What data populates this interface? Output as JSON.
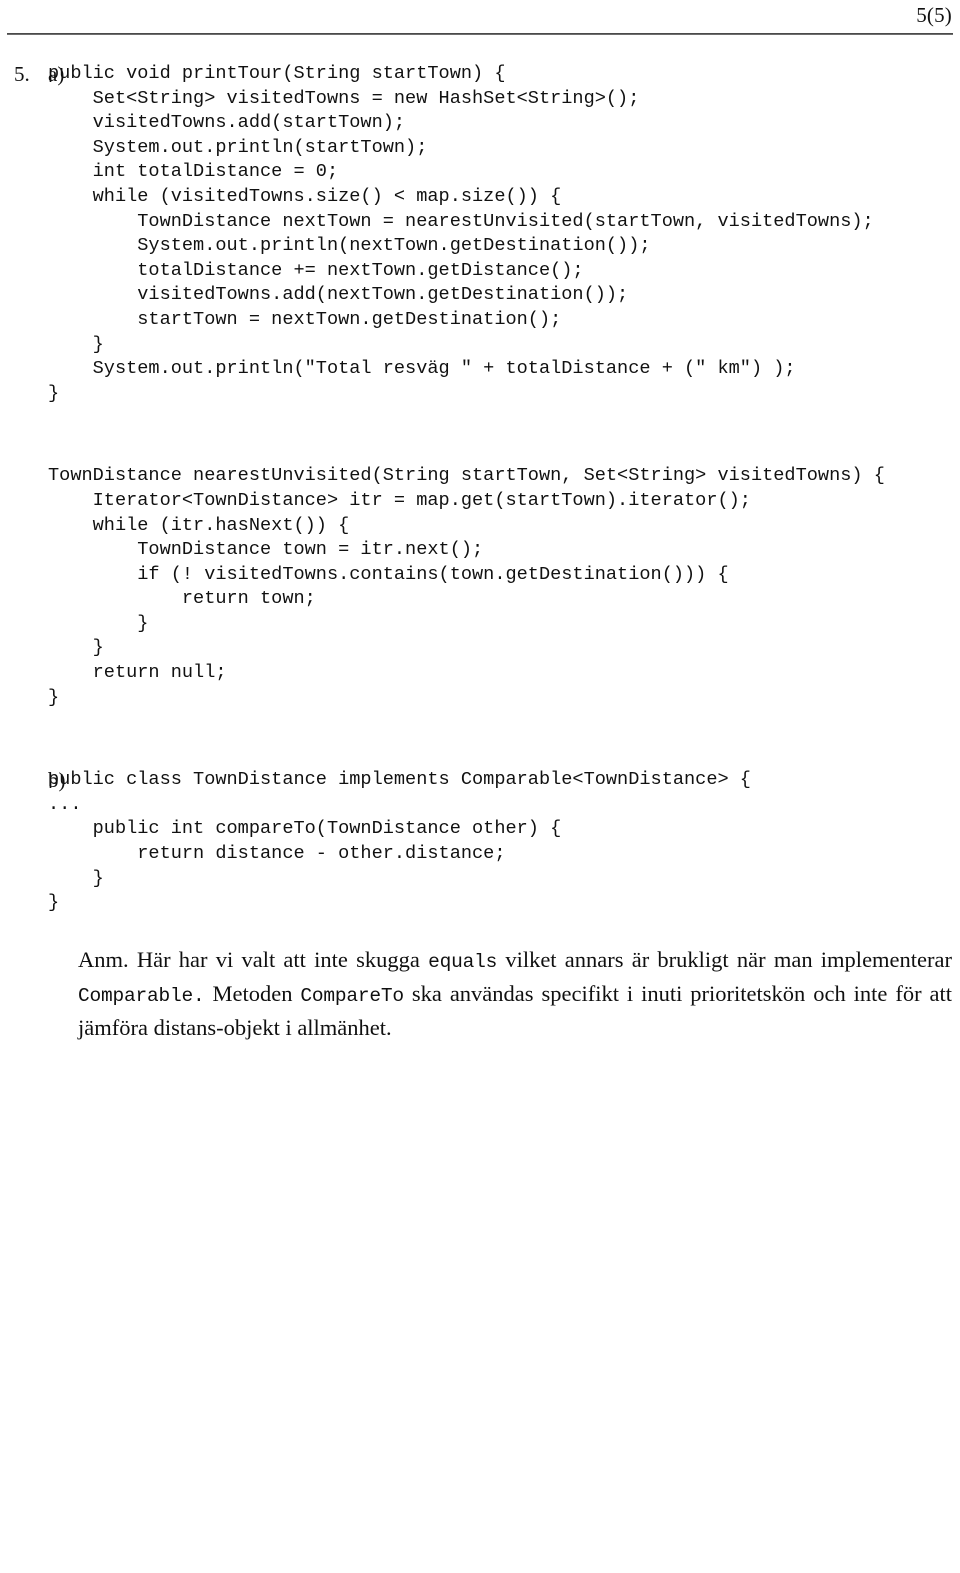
{
  "header": {
    "page_number": "5(5)"
  },
  "exercise": {
    "number": "5.",
    "parts": [
      {
        "label": "a)",
        "code_blocks": [
          {
            "lines": [
              "public void printTour(String startTown) {",
              "    Set<String> visitedTowns = new HashSet<String>();",
              "    visitedTowns.add(startTown);",
              "    System.out.println(startTown);",
              "    int totalDistance = 0;",
              "    while (visitedTowns.size() < map.size()) {",
              "        TownDistance nextTown = nearestUnvisited(startTown, visitedTowns);",
              "        System.out.println(nextTown.getDestination());",
              "        totalDistance += nextTown.getDistance();",
              "        visitedTowns.add(nextTown.getDestination());",
              "        startTown = nextTown.getDestination();",
              "    }",
              "    System.out.println(\"Total resväg \" + totalDistance + (\" km\") );",
              "}"
            ]
          },
          {
            "lines": [
              "TownDistance nearestUnvisited(String startTown, Set<String> visitedTowns) {",
              "    Iterator<TownDistance> itr = map.get(startTown).iterator();",
              "    while (itr.hasNext()) {",
              "        TownDistance town = itr.next();",
              "        if (! visitedTowns.contains(town.getDestination())) {",
              "            return town;",
              "        }",
              "    }",
              "    return null;",
              "}"
            ]
          }
        ]
      },
      {
        "label": "b)",
        "code_blocks": [
          {
            "lines": [
              "public class TownDistance implements Comparable<TownDistance> {",
              "...",
              "    public int compareTo(TownDistance other) {",
              "        return distance - other.distance;",
              "    }",
              "}"
            ]
          }
        ]
      }
    ]
  },
  "note": {
    "segments": [
      {
        "text": "Anm. Här har vi valt att inte skugga ",
        "mono": false
      },
      {
        "text": "equals",
        "mono": true
      },
      {
        "text": " vilket annars är brukligt när man implementerar ",
        "mono": false
      },
      {
        "text": "Comparable.",
        "mono": true
      },
      {
        "text": " Metoden ",
        "mono": false
      },
      {
        "text": "CompareTo",
        "mono": true
      },
      {
        "text": " ska användas specifikt i inuti prioritetskön och inte för att jämföra distans-objekt i allmänhet.",
        "mono": false
      }
    ]
  }
}
